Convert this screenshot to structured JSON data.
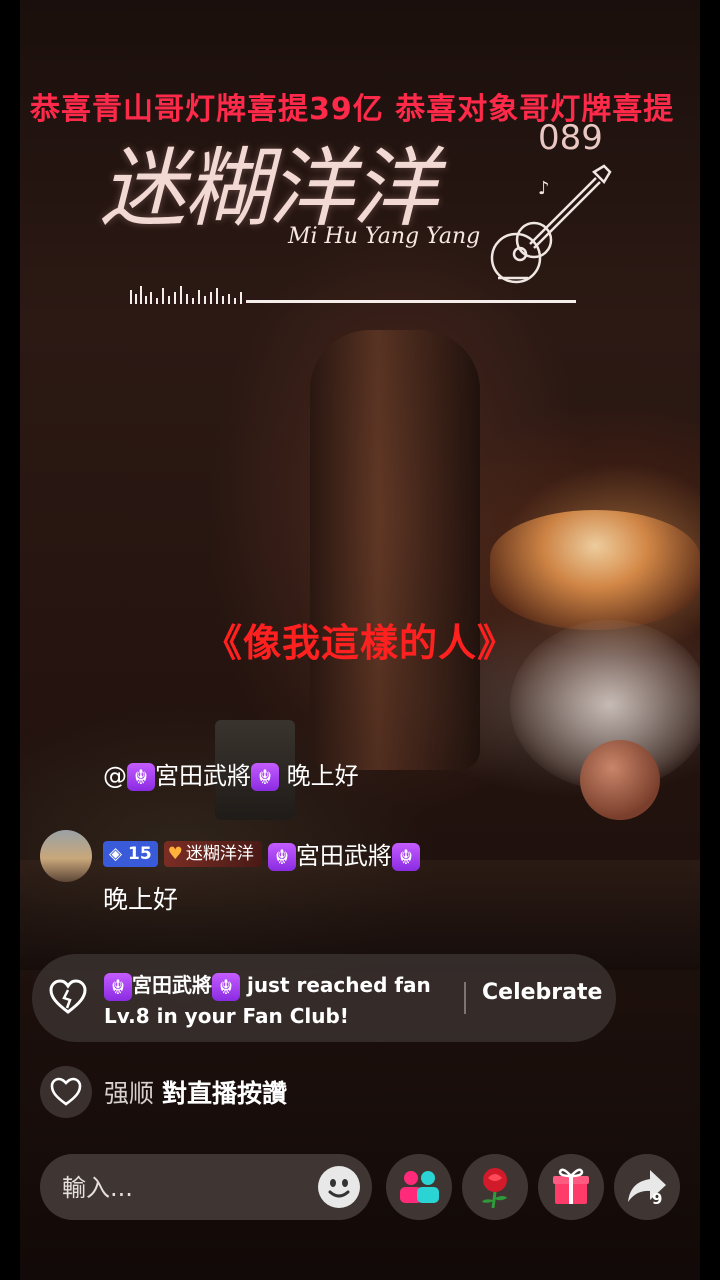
{
  "ticker_text": "恭喜青山哥灯牌喜提39亿 恭喜对象哥灯牌喜提",
  "logo": {
    "title_cn": "迷糊洋洋",
    "number": "089",
    "title_en": "Mi Hu Yang Yang"
  },
  "song_title": "《像我這樣的人》",
  "comments": [
    {
      "mention": "@",
      "user": "宮田武將",
      "text": "晚上好"
    },
    {
      "level": "15",
      "fan_club_badge": "迷糊洋洋",
      "user": "宮田武將",
      "text": "晚上好"
    }
  ],
  "fan_notice": {
    "user": "宮田武將",
    "text_after_user": " just reached fan Lv.8 in your Fan Club!",
    "button_label": "Celebrate"
  },
  "like_event": {
    "user": "强顺",
    "action": "對直播按讚"
  },
  "input": {
    "placeholder": "輸入..."
  },
  "toolbar": {
    "icons": [
      "emoji-icon",
      "guest-icon",
      "rose-gift-icon",
      "gift-box-icon",
      "share-icon"
    ],
    "share_count": "9"
  },
  "colors": {
    "ticker": "#ff2a4a",
    "song_title": "#ff2020",
    "level_badge": "#3a5bd9",
    "symbol_badge": "#a040f0"
  }
}
